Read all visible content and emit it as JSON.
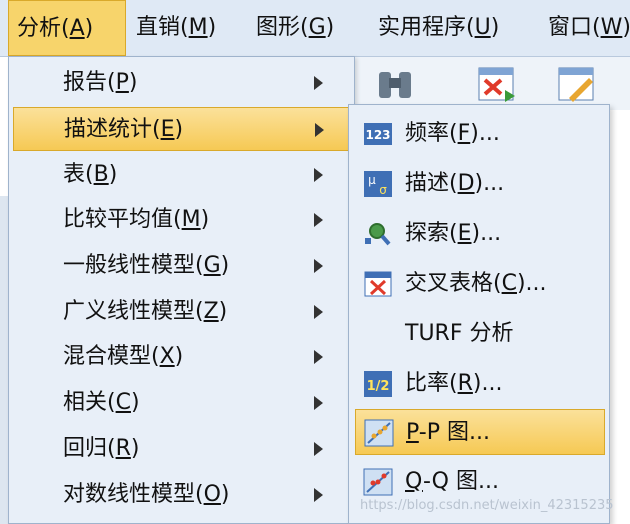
{
  "menubar": {
    "items": [
      {
        "label": "分析(",
        "key": "A",
        "end": ")"
      },
      {
        "label": "直销(",
        "key": "M",
        "end": ")"
      },
      {
        "label": "图形(",
        "key": "G",
        "end": ")"
      },
      {
        "label": "实用程序(",
        "key": "U",
        "end": ")"
      },
      {
        "label": "窗口(",
        "key": "W",
        "end": ")"
      }
    ]
  },
  "analyze_menu": {
    "items": [
      {
        "label": "报告(",
        "key": "P",
        "end": ")"
      },
      {
        "label": "描述统计(",
        "key": "E",
        "end": ")"
      },
      {
        "label": "表(",
        "key": "B",
        "end": ")"
      },
      {
        "label": "比较平均值(",
        "key": "M",
        "end": ")"
      },
      {
        "label": "一般线性模型(",
        "key": "G",
        "end": ")"
      },
      {
        "label": "广义线性模型(",
        "key": "Z",
        "end": ")"
      },
      {
        "label": "混合模型(",
        "key": "X",
        "end": ")"
      },
      {
        "label": "相关(",
        "key": "C",
        "end": ")"
      },
      {
        "label": "回归(",
        "key": "R",
        "end": ")"
      },
      {
        "label": "对数线性模型(",
        "key": "O",
        "end": ")"
      }
    ]
  },
  "descriptive_submenu": {
    "items": [
      {
        "label": "频率(",
        "key": "F",
        "end": ")..."
      },
      {
        "label": "描述(",
        "key": "D",
        "end": ")..."
      },
      {
        "label": "探索(",
        "key": "E",
        "end": ")..."
      },
      {
        "label": "交叉表格(",
        "key": "C",
        "end": ")..."
      },
      {
        "label": "TURF 分析",
        "key": "",
        "end": ""
      },
      {
        "label": "比率(",
        "key": "R",
        "end": ")..."
      },
      {
        "label": "",
        "key": "P",
        "end": "-P 图..."
      },
      {
        "label": "",
        "key": "Q",
        "end": "-Q 图..."
      }
    ]
  },
  "watermark": "https://blog.csdn.net/weixin_42315235",
  "colors": {
    "highlight": "#f6c954",
    "menu_bg": "#e8eff8",
    "menubar_bg": "#dfe9f5"
  }
}
